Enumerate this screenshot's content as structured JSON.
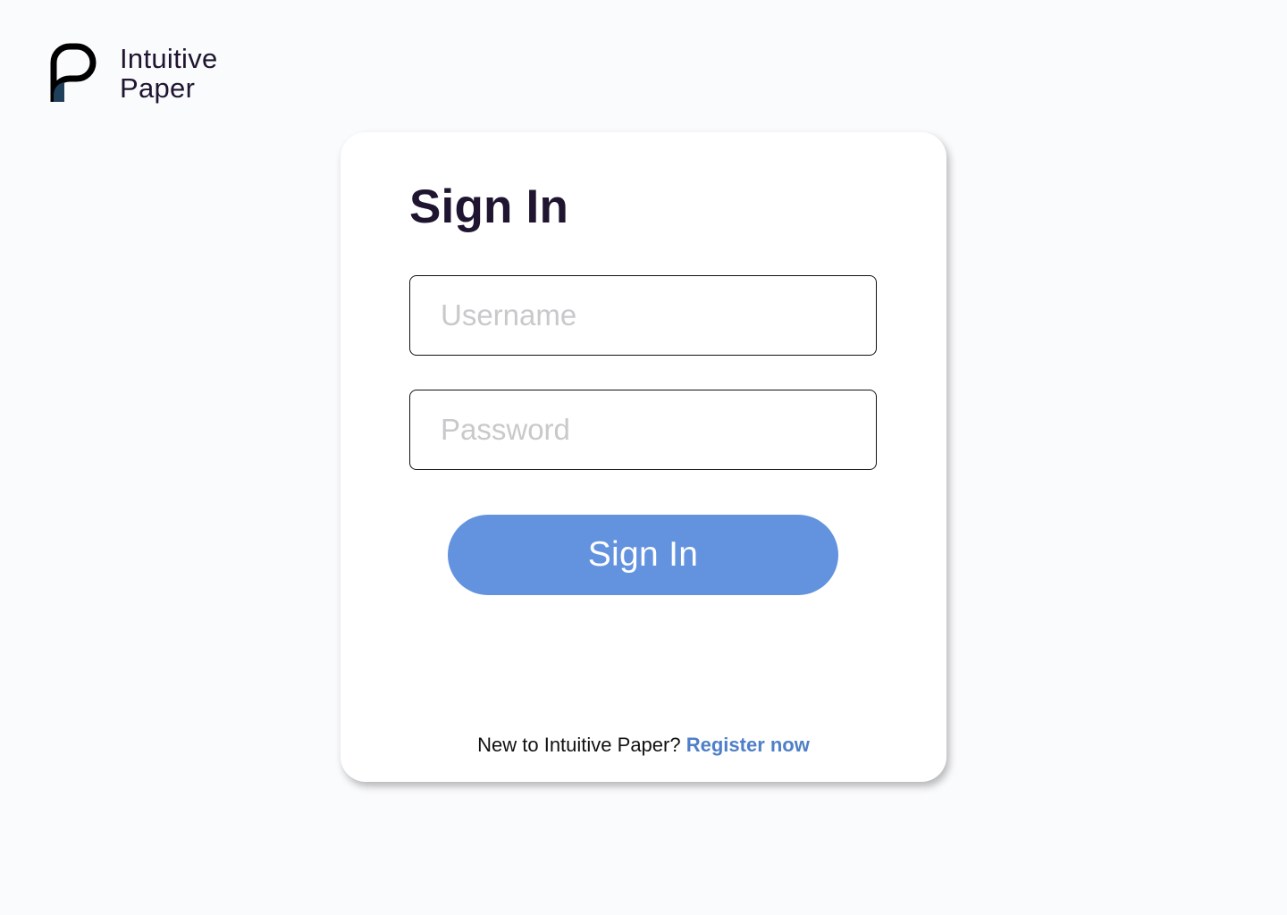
{
  "brand": {
    "name_line1": "Intuitive",
    "name_line2": "Paper",
    "logo_icon": "intuitive-paper-logo-icon"
  },
  "signin": {
    "title": "Sign In",
    "username_placeholder": "Username",
    "username_value": "",
    "password_placeholder": "Password",
    "password_value": "",
    "submit_label": "Sign In",
    "register_prompt": "New to Intuitive Paper?",
    "register_link": "Register now"
  },
  "colors": {
    "page_background": "#fafbfd",
    "card_background": "#ffffff",
    "text_dark": "#1f1530",
    "accent_button": "#6393df",
    "link": "#4f7fc8",
    "placeholder": "#c9c9cc"
  }
}
